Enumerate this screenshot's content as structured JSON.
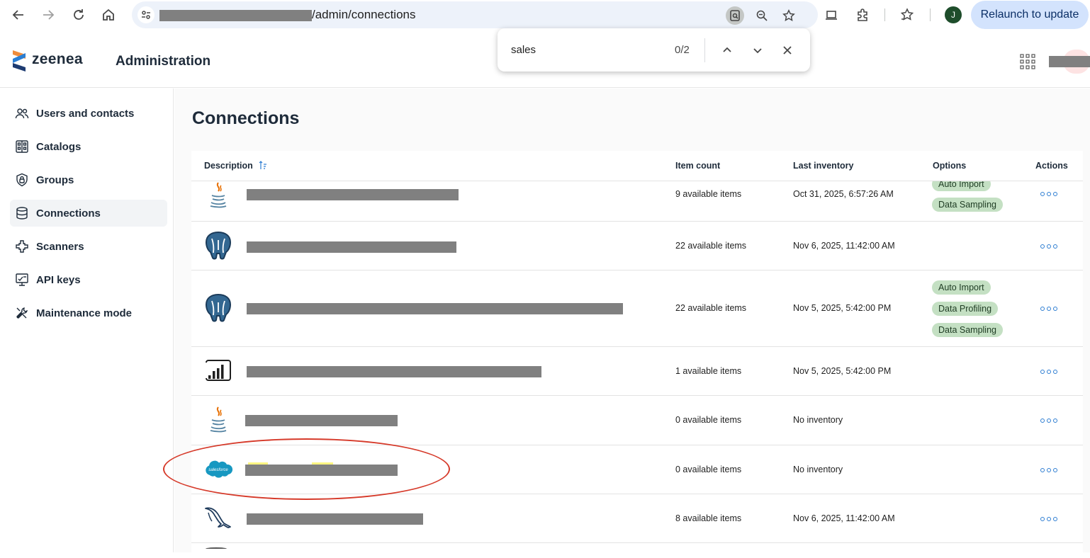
{
  "browser": {
    "url_path": "/admin/connections",
    "relaunch_label": "Relaunch to update",
    "profile_initial": "J"
  },
  "find_bar": {
    "query": "sales",
    "count": "0/2"
  },
  "header": {
    "brand": "zeenea",
    "title": "Administration"
  },
  "sidebar": {
    "items": [
      {
        "label": "Users and contacts",
        "icon": "users-icon"
      },
      {
        "label": "Catalogs",
        "icon": "catalogs-icon"
      },
      {
        "label": "Groups",
        "icon": "groups-icon"
      },
      {
        "label": "Connections",
        "icon": "database-icon",
        "active": true
      },
      {
        "label": "Scanners",
        "icon": "scanner-icon"
      },
      {
        "label": "API keys",
        "icon": "api-key-icon"
      },
      {
        "label": "Maintenance mode",
        "icon": "tools-icon"
      }
    ]
  },
  "main": {
    "title": "Connections",
    "columns": {
      "description": "Description",
      "item_count": "Item count",
      "last_inventory": "Last inventory",
      "options": "Options",
      "actions": "Actions"
    },
    "rows": [
      {
        "icon": "java-icon",
        "item_count": "9 available items",
        "last_inventory": "Oct 31, 2025, 6:57:26 AM",
        "options": [
          "Auto Import",
          "Data Sampling"
        ]
      },
      {
        "icon": "postgresql-icon",
        "item_count": "22 available items",
        "last_inventory": "Nov 6, 2025, 11:42:00 AM",
        "options": []
      },
      {
        "icon": "postgresql-icon",
        "item_count": "22 available items",
        "last_inventory": "Nov 5, 2025, 5:42:00 PM",
        "options": [
          "Auto Import",
          "Data Profiling",
          "Data Sampling"
        ]
      },
      {
        "icon": "power-bi-icon",
        "item_count": "1 available items",
        "last_inventory": "Nov 5, 2025, 5:42:00 PM",
        "options": []
      },
      {
        "icon": "java-icon",
        "item_count": "0 available items",
        "last_inventory": "No inventory",
        "options": []
      },
      {
        "icon": "salesforce-icon",
        "icon_text": "salesforce",
        "item_count": "0 available items",
        "last_inventory": "No inventory",
        "options": []
      },
      {
        "icon": "mysql-icon",
        "item_count": "8 available items",
        "last_inventory": "Nov 6, 2025, 11:42:00 AM",
        "options": []
      }
    ]
  },
  "colors": {
    "accent": "#2d7dd2",
    "badge_bg": "#c4e0c3",
    "annotation": "#d63a2a",
    "relaunch_bg": "#d3e3fd"
  }
}
